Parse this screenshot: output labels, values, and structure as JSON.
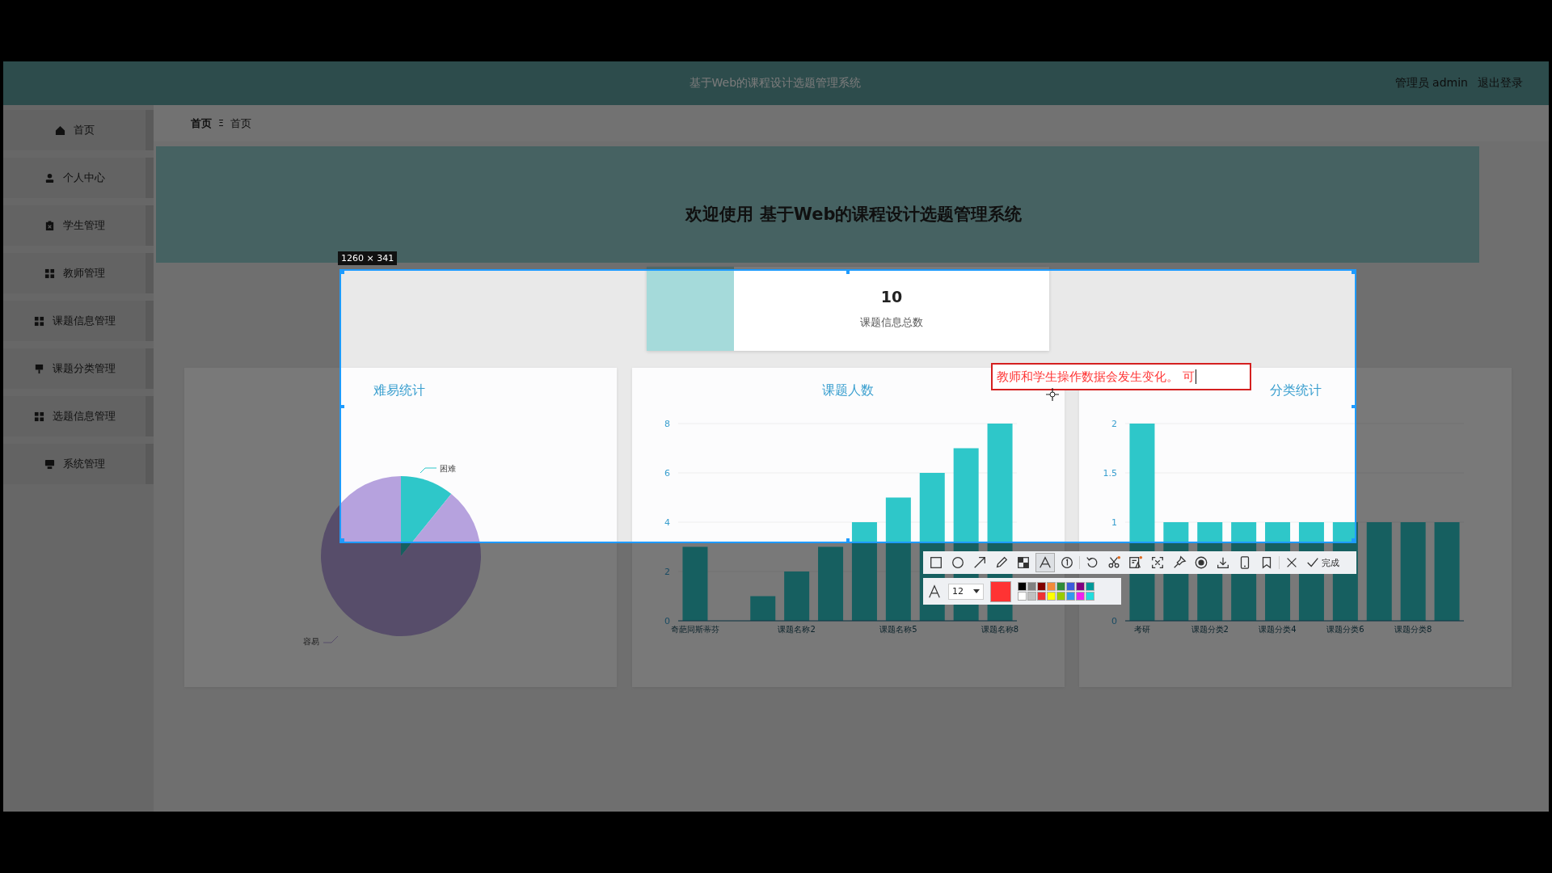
{
  "header": {
    "title": "基于Web的课程设计选题管理系统",
    "user": "管理员 admin",
    "logout": "退出登录"
  },
  "sidebar": {
    "items": [
      {
        "label": "首页"
      },
      {
        "label": "个人中心"
      },
      {
        "label": "学生管理"
      },
      {
        "label": "教师管理"
      },
      {
        "label": "课题信息管理"
      },
      {
        "label": "课题分类管理"
      },
      {
        "label": "选题信息管理"
      },
      {
        "label": "系统管理"
      }
    ]
  },
  "breadcrumb": {
    "items": [
      "首页",
      "首页"
    ],
    "separator": "Ξ"
  },
  "welcome": "欢迎使用 基于Web的课程设计选题管理系统",
  "stat": {
    "value": "10",
    "label": "课题信息总数"
  },
  "charts": [
    {
      "kind": "pie",
      "title": "难易统计",
      "slices": [
        {
          "label": "困难",
          "color": "#2ec7c9"
        },
        {
          "label": "容易",
          "color": "#b6a2de"
        }
      ]
    },
    {
      "kind": "bar",
      "title": "课题人数",
      "chart_data": {
        "type": "bar",
        "categories": [
          "奇葩同斯蒂芬",
          null,
          null,
          "课题名称2",
          null,
          null,
          "课题名称5",
          null,
          null,
          "课题名称8"
        ],
        "values": [
          3,
          0,
          1,
          2,
          3,
          4,
          5,
          6,
          7,
          8
        ],
        "ylim": [
          0,
          8
        ],
        "yticks": [
          0,
          2,
          4,
          6,
          8
        ]
      }
    },
    {
      "kind": "bar",
      "title": "分类统计",
      "chart_data": {
        "type": "bar",
        "categories": [
          "考研",
          null,
          "课题分类2",
          null,
          "课题分类4",
          null,
          "课题分类6",
          null,
          "课题分类8",
          null
        ],
        "values": [
          2,
          1,
          1,
          1,
          1,
          1,
          1,
          1,
          1,
          1
        ],
        "ylim": [
          0,
          2
        ],
        "yticks": [
          0,
          1,
          1.5,
          2
        ]
      }
    }
  ],
  "screenshot_tool": {
    "size_label": "1260 × 341",
    "annotation": "教师和学生操作数据会发生变化。 可",
    "tools": [
      {
        "kind": "rectangle",
        "selected": false
      },
      {
        "kind": "circle",
        "selected": false
      },
      {
        "kind": "arrow",
        "selected": false
      },
      {
        "kind": "pencil",
        "selected": false
      },
      {
        "kind": "mosaic",
        "selected": false
      },
      {
        "kind": "text",
        "selected": true
      },
      {
        "kind": "number",
        "selected": false
      },
      {
        "kind": "undo",
        "selected": false
      },
      {
        "kind": "scissors",
        "selected": false
      },
      {
        "kind": "ocr",
        "selected": false
      },
      {
        "kind": "scan",
        "selected": false
      },
      {
        "kind": "pin",
        "selected": false
      },
      {
        "kind": "record",
        "selected": false
      },
      {
        "kind": "download",
        "selected": false
      },
      {
        "kind": "phone",
        "selected": false
      },
      {
        "kind": "bookmark",
        "selected": false
      },
      {
        "kind": "close",
        "selected": false
      }
    ],
    "done": "完成",
    "font_size": "12",
    "palette": [
      {
        "color": "#000000"
      },
      {
        "color": "#808080"
      },
      {
        "color": "#800000"
      },
      {
        "color": "#f28a3a"
      },
      {
        "color": "#2e8b3a"
      },
      {
        "color": "#3b5bdb"
      },
      {
        "color": "#800080"
      },
      {
        "color": "#009999"
      },
      {
        "color": "#ffffff"
      },
      {
        "color": "#c0c0c0"
      },
      {
        "color": "#ee3333"
      },
      {
        "color": "#ffff00"
      },
      {
        "color": "#99cc00"
      },
      {
        "color": "#3399ee"
      },
      {
        "color": "#ee22ee"
      },
      {
        "color": "#22dddd"
      }
    ]
  }
}
